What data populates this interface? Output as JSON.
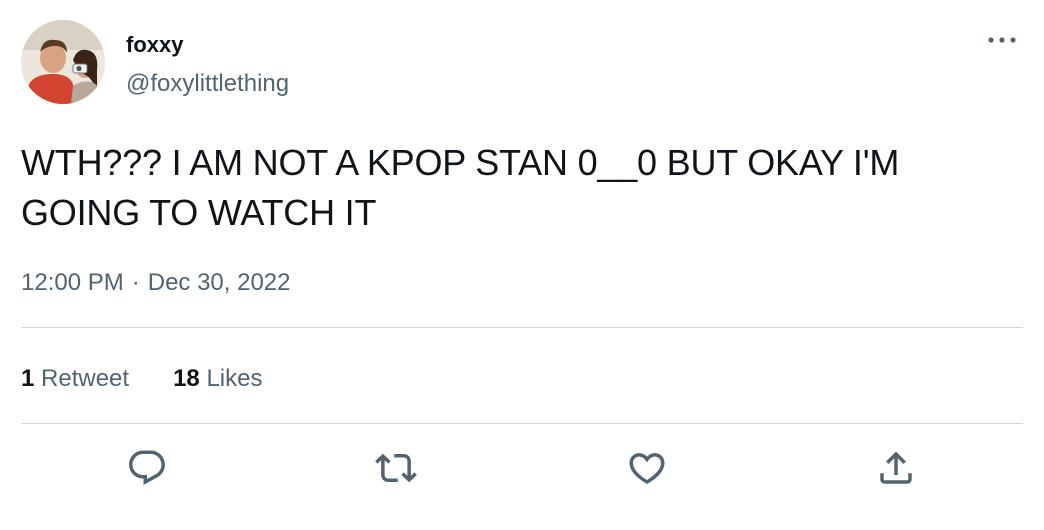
{
  "author": {
    "display_name": "foxxy",
    "handle": "@foxylittlething"
  },
  "tweet": {
    "text": "WTH??? I AM NOT A KPOP STAN 0__0 BUT OKAY I'M GOING TO WATCH IT",
    "time": "12:00 PM",
    "separator": "·",
    "date": "Dec 30, 2022"
  },
  "stats": {
    "retweets_count": "1",
    "retweets_label": "Retweet",
    "likes_count": "18",
    "likes_label": "Likes"
  },
  "icons": {
    "more": "more-dots-icon",
    "reply": "reply-icon",
    "retweet": "retweet-icon",
    "like": "heart-icon",
    "share": "share-icon"
  },
  "colors": {
    "text_primary": "#0f1419",
    "text_secondary": "#536471",
    "divider": "#cfd9de"
  }
}
